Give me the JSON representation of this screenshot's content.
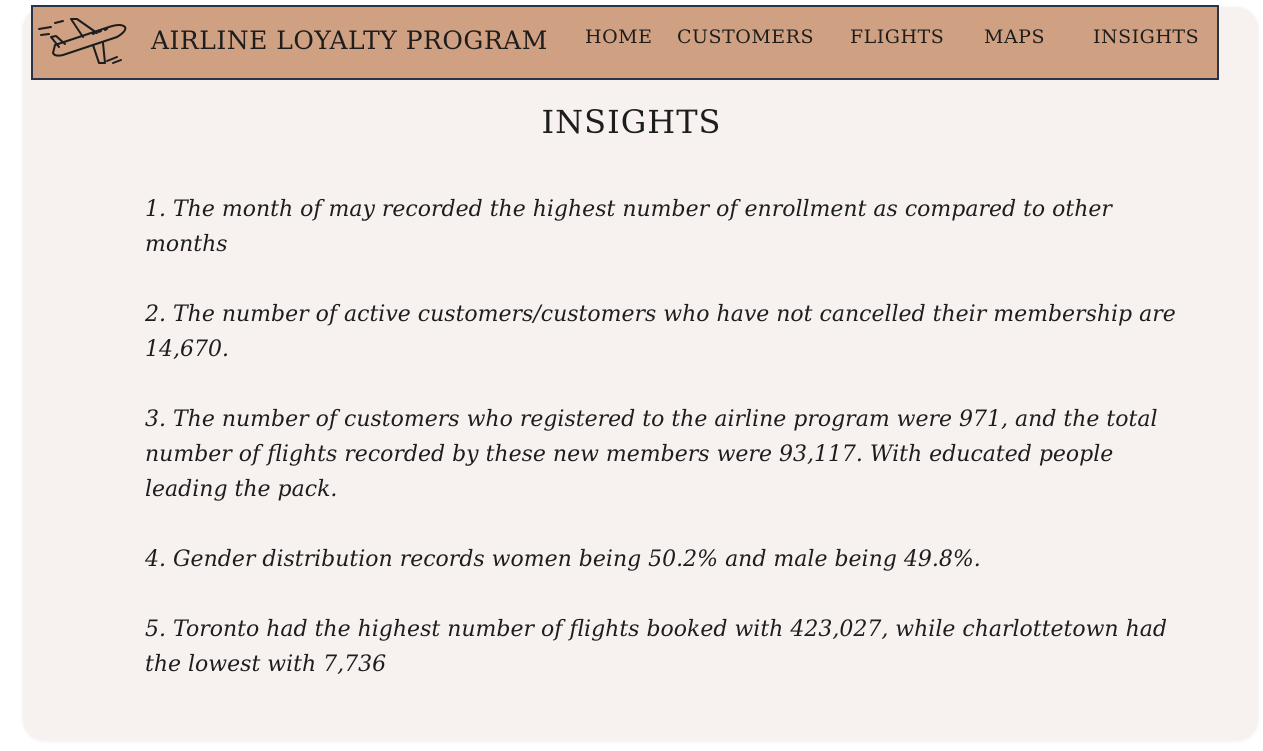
{
  "header": {
    "brand": "AIRLINE LOYALTY PROGRAM",
    "logo_icon": "airplane-icon",
    "nav": [
      {
        "label": "HOME"
      },
      {
        "label": "CUSTOMERS"
      },
      {
        "label": "FLIGHTS"
      },
      {
        "label": "MAPS"
      },
      {
        "label": "INSIGHTS"
      }
    ]
  },
  "main": {
    "title": "INSIGHTS",
    "insights": [
      "1. The month of may recorded the highest number of enrollment as compared to other months",
      "2. The number of active customers/customers who have not cancelled their membership are 14,670.",
      "3. The number of customers who registered to the airline program were 971, and the total number of flights recorded by these new members were 93,117. With educated people leading the pack.",
      "4. Gender distribution records women being 50.2% and male being 49.8%.",
      "5. Toronto had the highest number of flights booked with 423,027, while charlottetown had the lowest with 7,736"
    ]
  },
  "colors": {
    "navbar_bg": "#cfa082",
    "navbar_border": "#2b3446",
    "card_bg": "#f7f1ef",
    "text": "#1d1d1d"
  }
}
